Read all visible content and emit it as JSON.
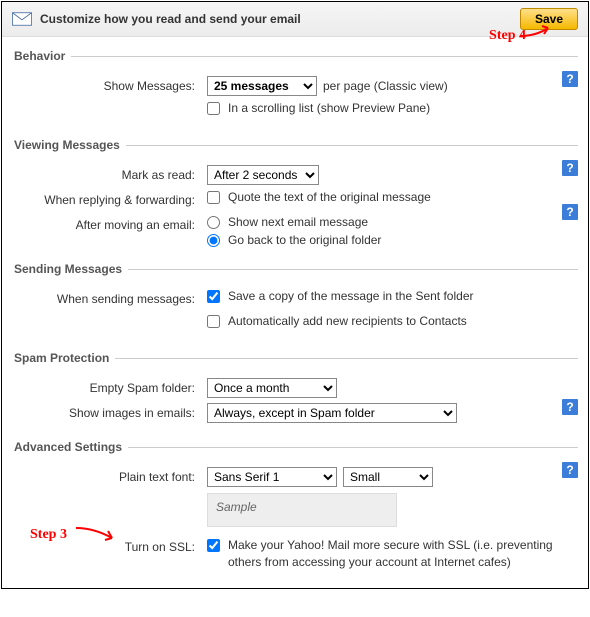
{
  "header": {
    "title": "Customize how you read and send your email",
    "save": "Save",
    "step4": "Step 4"
  },
  "behavior": {
    "legend": "Behavior",
    "showMessagesLabel": "Show Messages:",
    "perPage": "per page (Classic view)",
    "dropdown": "25 messages",
    "scrolling": "In a scrolling list (show Preview Pane)"
  },
  "viewing": {
    "legend": "Viewing Messages",
    "markAsReadLabel": "Mark as read:",
    "markAsRead": "After 2 seconds",
    "replyLabel": "When replying & forwarding:",
    "quote": "Quote the text of the original message",
    "afterMoveLabel": "After moving an email:",
    "showNext": "Show next email message",
    "goBack": "Go back to the original folder"
  },
  "sending": {
    "legend": "Sending Messages",
    "label": "When sending messages:",
    "saveCopy": "Save a copy of the message in the Sent folder",
    "autoAdd": "Automatically add new recipients to Contacts"
  },
  "spam": {
    "legend": "Spam Protection",
    "emptyLabel": "Empty Spam folder:",
    "emptyVal": "Once a month",
    "imagesLabel": "Show images in emails:",
    "imagesVal": "Always, except in Spam folder"
  },
  "advanced": {
    "legend": "Advanced Settings",
    "fontLabel": "Plain text font:",
    "fontFamily": "Sans Serif 1",
    "fontSize": "Small",
    "sample": "Sample",
    "sslLabel": "Turn on SSL:",
    "sslText": "Make your Yahoo! Mail more secure with SSL (i.e. preventing others from accessing your account at Internet cafes)",
    "step3": "Step 3"
  }
}
